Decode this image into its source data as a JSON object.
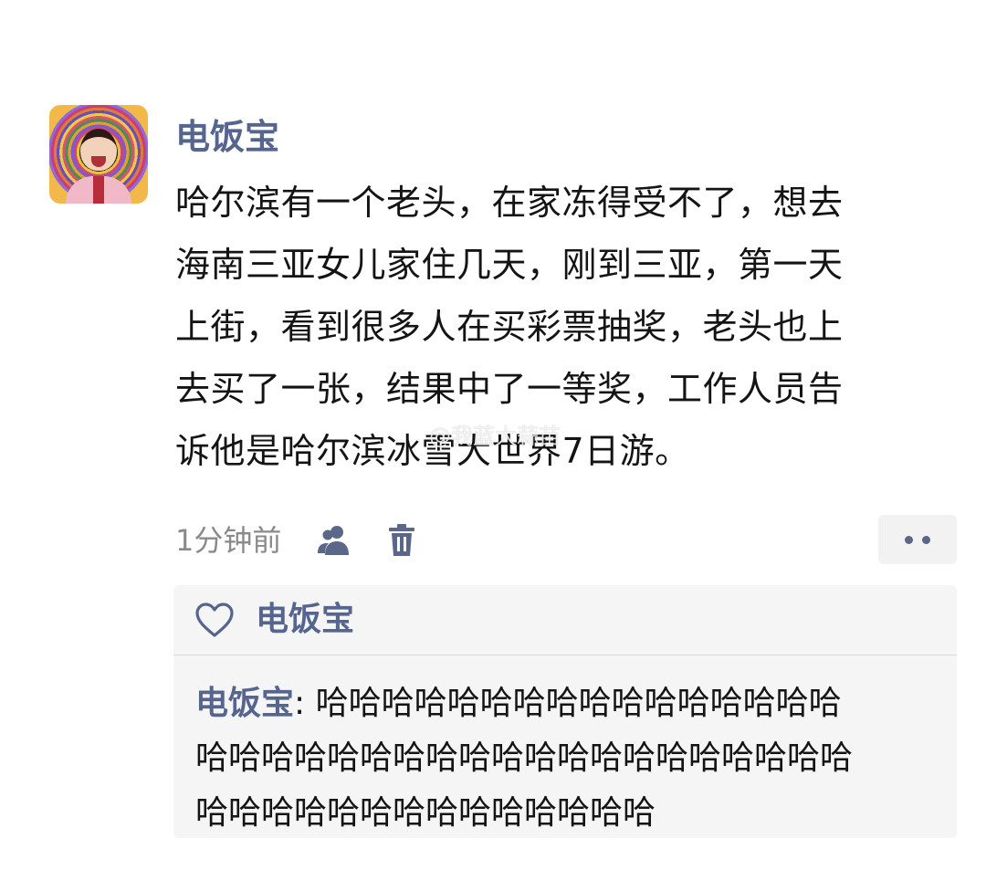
{
  "post": {
    "author": "电饭宝",
    "text_lines": [
      "哈尔滨有一个老头，在家冻得受不了，想去",
      "海南三亚女儿家住几天，刚到三亚，第一天",
      "上街，看到很多人在买彩票抽奖，老头也上",
      "去买了一张，结果中了一等奖，工作人员告",
      "诉他是哈尔滨冰雪大世界7日游。"
    ],
    "watermark": "@我蓝大蒜苗",
    "timestamp": "1分钟前"
  },
  "icons": {
    "privacy": "people-icon",
    "delete": "trash-icon",
    "more": "more-dots-icon",
    "like": "heart-icon"
  },
  "likes": {
    "names": "电饭宝"
  },
  "comments": [
    {
      "author": "电饭宝",
      "separator": ": ",
      "line1": "哈哈哈哈哈哈哈哈哈哈哈哈哈哈哈哈",
      "line2": "哈哈哈哈哈哈哈哈哈哈哈哈哈哈哈哈哈哈哈哈",
      "line3": "哈哈哈哈哈哈哈哈哈哈哈哈哈哈"
    }
  ],
  "colors": {
    "name_blue": "#56658e",
    "text": "#141414",
    "muted": "#8a8a8a",
    "panel": "#f5f5f5"
  }
}
